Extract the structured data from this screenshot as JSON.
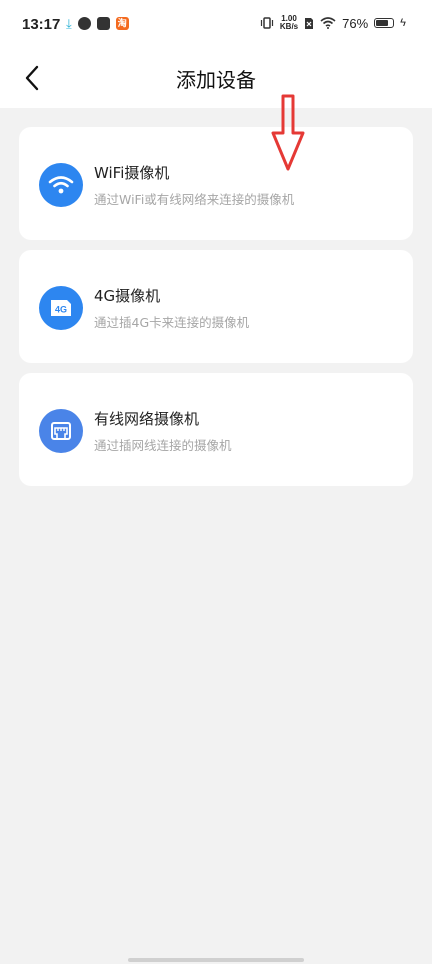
{
  "status_bar": {
    "time": "13:17",
    "net_speed_value": "1.00",
    "net_speed_unit": "KB/s",
    "battery_percent_text": "76%",
    "battery_level": 0.76,
    "icons": [
      "download-icon",
      "app-icon",
      "mail-icon",
      "taobao-icon",
      "vibrate-icon",
      "sim-off-icon",
      "wifi-icon",
      "battery-icon",
      "charging-icon"
    ],
    "notification_badge_text": "淘"
  },
  "navbar": {
    "title": "添加设备",
    "back_icon": "chevron-left-icon"
  },
  "devices": [
    {
      "title": "WiFi摄像机",
      "description": "通过WiFi或有线网络来连接的摄像机",
      "icon": "wifi-icon",
      "color": "#2d86f0"
    },
    {
      "title": "4G摄像机",
      "description": "通过插4G卡来连接的摄像机",
      "icon": "4g-icon",
      "icon_text": "4G",
      "color": "#2d86f0"
    },
    {
      "title": "有线网络摄像机",
      "description": "通过插网线连接的摄像机",
      "icon": "ethernet-port-icon",
      "color": "#4a84e8"
    }
  ],
  "annotation": {
    "icon": "down-arrow-icon",
    "color": "#e53935"
  },
  "colors": {
    "accent": "#2d86f0",
    "background": "#f2f2f2",
    "card": "#ffffff"
  }
}
